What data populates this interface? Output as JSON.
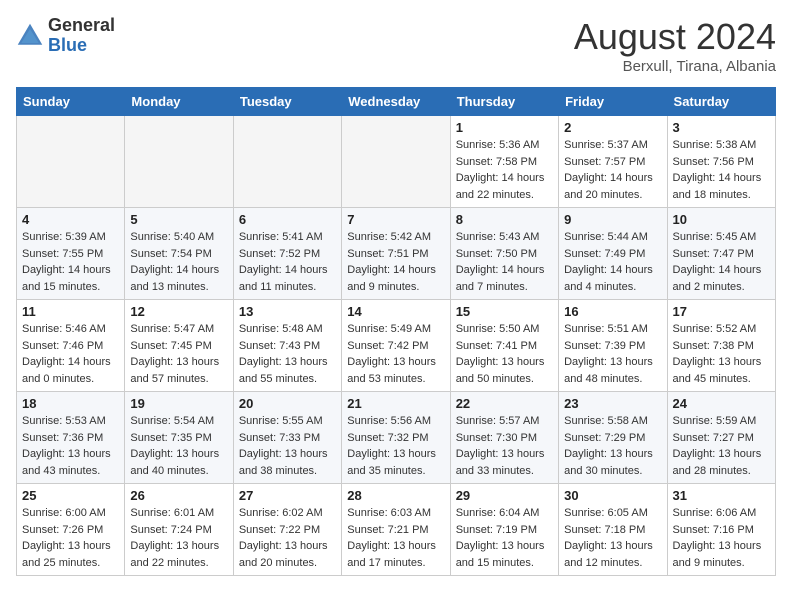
{
  "logo": {
    "general": "General",
    "blue": "Blue"
  },
  "title": {
    "month_year": "August 2024",
    "location": "Berxull, Tirana, Albania"
  },
  "days_of_week": [
    "Sunday",
    "Monday",
    "Tuesday",
    "Wednesday",
    "Thursday",
    "Friday",
    "Saturday"
  ],
  "weeks": [
    [
      {
        "day": "",
        "empty": true
      },
      {
        "day": "",
        "empty": true
      },
      {
        "day": "",
        "empty": true
      },
      {
        "day": "",
        "empty": true
      },
      {
        "day": "1",
        "sunrise": "5:36 AM",
        "sunset": "7:58 PM",
        "daylight": "14 hours and 22 minutes."
      },
      {
        "day": "2",
        "sunrise": "5:37 AM",
        "sunset": "7:57 PM",
        "daylight": "14 hours and 20 minutes."
      },
      {
        "day": "3",
        "sunrise": "5:38 AM",
        "sunset": "7:56 PM",
        "daylight": "14 hours and 18 minutes."
      }
    ],
    [
      {
        "day": "4",
        "sunrise": "5:39 AM",
        "sunset": "7:55 PM",
        "daylight": "14 hours and 15 minutes."
      },
      {
        "day": "5",
        "sunrise": "5:40 AM",
        "sunset": "7:54 PM",
        "daylight": "14 hours and 13 minutes."
      },
      {
        "day": "6",
        "sunrise": "5:41 AM",
        "sunset": "7:52 PM",
        "daylight": "14 hours and 11 minutes."
      },
      {
        "day": "7",
        "sunrise": "5:42 AM",
        "sunset": "7:51 PM",
        "daylight": "14 hours and 9 minutes."
      },
      {
        "day": "8",
        "sunrise": "5:43 AM",
        "sunset": "7:50 PM",
        "daylight": "14 hours and 7 minutes."
      },
      {
        "day": "9",
        "sunrise": "5:44 AM",
        "sunset": "7:49 PM",
        "daylight": "14 hours and 4 minutes."
      },
      {
        "day": "10",
        "sunrise": "5:45 AM",
        "sunset": "7:47 PM",
        "daylight": "14 hours and 2 minutes."
      }
    ],
    [
      {
        "day": "11",
        "sunrise": "5:46 AM",
        "sunset": "7:46 PM",
        "daylight": "14 hours and 0 minutes."
      },
      {
        "day": "12",
        "sunrise": "5:47 AM",
        "sunset": "7:45 PM",
        "daylight": "13 hours and 57 minutes."
      },
      {
        "day": "13",
        "sunrise": "5:48 AM",
        "sunset": "7:43 PM",
        "daylight": "13 hours and 55 minutes."
      },
      {
        "day": "14",
        "sunrise": "5:49 AM",
        "sunset": "7:42 PM",
        "daylight": "13 hours and 53 minutes."
      },
      {
        "day": "15",
        "sunrise": "5:50 AM",
        "sunset": "7:41 PM",
        "daylight": "13 hours and 50 minutes."
      },
      {
        "day": "16",
        "sunrise": "5:51 AM",
        "sunset": "7:39 PM",
        "daylight": "13 hours and 48 minutes."
      },
      {
        "day": "17",
        "sunrise": "5:52 AM",
        "sunset": "7:38 PM",
        "daylight": "13 hours and 45 minutes."
      }
    ],
    [
      {
        "day": "18",
        "sunrise": "5:53 AM",
        "sunset": "7:36 PM",
        "daylight": "13 hours and 43 minutes."
      },
      {
        "day": "19",
        "sunrise": "5:54 AM",
        "sunset": "7:35 PM",
        "daylight": "13 hours and 40 minutes."
      },
      {
        "day": "20",
        "sunrise": "5:55 AM",
        "sunset": "7:33 PM",
        "daylight": "13 hours and 38 minutes."
      },
      {
        "day": "21",
        "sunrise": "5:56 AM",
        "sunset": "7:32 PM",
        "daylight": "13 hours and 35 minutes."
      },
      {
        "day": "22",
        "sunrise": "5:57 AM",
        "sunset": "7:30 PM",
        "daylight": "13 hours and 33 minutes."
      },
      {
        "day": "23",
        "sunrise": "5:58 AM",
        "sunset": "7:29 PM",
        "daylight": "13 hours and 30 minutes."
      },
      {
        "day": "24",
        "sunrise": "5:59 AM",
        "sunset": "7:27 PM",
        "daylight": "13 hours and 28 minutes."
      }
    ],
    [
      {
        "day": "25",
        "sunrise": "6:00 AM",
        "sunset": "7:26 PM",
        "daylight": "13 hours and 25 minutes."
      },
      {
        "day": "26",
        "sunrise": "6:01 AM",
        "sunset": "7:24 PM",
        "daylight": "13 hours and 22 minutes."
      },
      {
        "day": "27",
        "sunrise": "6:02 AM",
        "sunset": "7:22 PM",
        "daylight": "13 hours and 20 minutes."
      },
      {
        "day": "28",
        "sunrise": "6:03 AM",
        "sunset": "7:21 PM",
        "daylight": "13 hours and 17 minutes."
      },
      {
        "day": "29",
        "sunrise": "6:04 AM",
        "sunset": "7:19 PM",
        "daylight": "13 hours and 15 minutes."
      },
      {
        "day": "30",
        "sunrise": "6:05 AM",
        "sunset": "7:18 PM",
        "daylight": "13 hours and 12 minutes."
      },
      {
        "day": "31",
        "sunrise": "6:06 AM",
        "sunset": "7:16 PM",
        "daylight": "13 hours and 9 minutes."
      }
    ]
  ],
  "labels": {
    "sunrise": "Sunrise:",
    "sunset": "Sunset:",
    "daylight": "Daylight:"
  }
}
